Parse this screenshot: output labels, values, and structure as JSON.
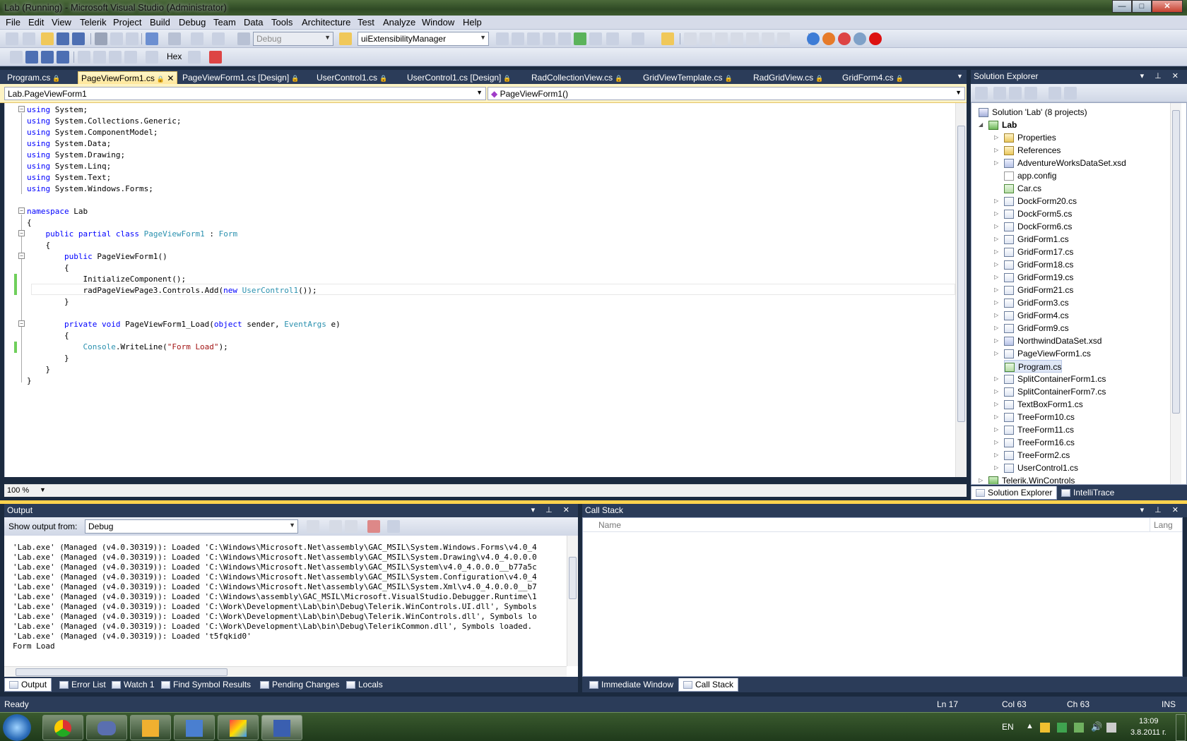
{
  "window": {
    "title": "Lab (Running) - Microsoft Visual Studio (Administrator)",
    "min": "—",
    "max": "□",
    "close": "✕"
  },
  "menu": [
    "File",
    "Edit",
    "View",
    "Telerik",
    "Project",
    "Build",
    "Debug",
    "Team",
    "Data",
    "Tools",
    "Architecture",
    "Test",
    "Analyze",
    "Window",
    "Help"
  ],
  "toolbar": {
    "config": "Debug",
    "find_combo": "uiExtensibilityManager",
    "hex": "Hex"
  },
  "doc_tabs": [
    {
      "label": "Program.cs",
      "active": false
    },
    {
      "label": "PageViewForm1.cs",
      "active": true
    },
    {
      "label": "PageViewForm1.cs [Design]",
      "active": false
    },
    {
      "label": "UserControl1.cs",
      "active": false
    },
    {
      "label": "UserControl1.cs [Design]",
      "active": false
    },
    {
      "label": "RadCollectionView.cs",
      "active": false
    },
    {
      "label": "GridViewTemplate.cs",
      "active": false
    },
    {
      "label": "RadGridView.cs",
      "active": false
    },
    {
      "label": "GridForm4.cs",
      "active": false
    }
  ],
  "nav": {
    "type_combo": "Lab.PageViewForm1",
    "member_combo": "PageViewForm1()"
  },
  "editor": {
    "zoom": "100 %"
  },
  "code_lines": [
    [
      [
        "using",
        "kw"
      ],
      [
        " System;",
        ""
      ]
    ],
    [
      [
        "using",
        "kw"
      ],
      [
        " System.Collections.Generic;",
        ""
      ]
    ],
    [
      [
        "using",
        "kw"
      ],
      [
        " System.ComponentModel;",
        ""
      ]
    ],
    [
      [
        "using",
        "kw"
      ],
      [
        " System.Data;",
        ""
      ]
    ],
    [
      [
        "using",
        "kw"
      ],
      [
        " System.Drawing;",
        ""
      ]
    ],
    [
      [
        "using",
        "kw"
      ],
      [
        " System.Linq;",
        ""
      ]
    ],
    [
      [
        "using",
        "kw"
      ],
      [
        " System.Text;",
        ""
      ]
    ],
    [
      [
        "using",
        "kw"
      ],
      [
        " System.Windows.Forms;",
        ""
      ]
    ],
    [],
    [
      [
        "namespace",
        "kw"
      ],
      [
        " Lab",
        ""
      ]
    ],
    [
      [
        "{",
        ""
      ]
    ],
    [
      [
        "    ",
        ""
      ],
      [
        "public",
        "kw"
      ],
      [
        " ",
        ""
      ],
      [
        "partial",
        "kw"
      ],
      [
        " ",
        ""
      ],
      [
        "class",
        "kw"
      ],
      [
        " ",
        ""
      ],
      [
        "PageViewForm1",
        "ty"
      ],
      [
        " : ",
        ""
      ],
      [
        "Form",
        "ty"
      ]
    ],
    [
      [
        "    {",
        ""
      ]
    ],
    [
      [
        "        ",
        ""
      ],
      [
        "public",
        "kw"
      ],
      [
        " PageViewForm1()",
        ""
      ]
    ],
    [
      [
        "        {",
        ""
      ]
    ],
    [
      [
        "            InitializeComponent();",
        ""
      ]
    ],
    [
      [
        "            radPageViewPage3.Controls.Add(",
        ""
      ],
      [
        "new",
        "kw"
      ],
      [
        " ",
        ""
      ],
      [
        "UserControl1",
        "ty"
      ],
      [
        "());",
        ""
      ]
    ],
    [
      [
        "        }",
        ""
      ]
    ],
    [],
    [
      [
        "        ",
        ""
      ],
      [
        "private",
        "kw"
      ],
      [
        " ",
        ""
      ],
      [
        "void",
        "kw"
      ],
      [
        " PageViewForm1_Load(",
        ""
      ],
      [
        "object",
        "kw"
      ],
      [
        " sender, ",
        ""
      ],
      [
        "EventArgs",
        "ty"
      ],
      [
        " e)",
        ""
      ]
    ],
    [
      [
        "        {",
        ""
      ]
    ],
    [
      [
        "            ",
        ""
      ],
      [
        "Console",
        "ty"
      ],
      [
        ".WriteLine(",
        ""
      ],
      [
        "\"Form Load\"",
        "st"
      ],
      [
        ");",
        ""
      ]
    ],
    [
      [
        "        }",
        ""
      ]
    ],
    [
      [
        "    }",
        ""
      ]
    ],
    [
      [
        "}",
        ""
      ]
    ]
  ],
  "solution_explorer": {
    "title": "Solution Explorer",
    "items": [
      {
        "label": "Solution 'Lab' (8 projects)",
        "indent": 0,
        "icon": "sol",
        "exp": ""
      },
      {
        "label": "Lab",
        "indent": 1,
        "icon": "proj",
        "exp": "◢",
        "bold": true
      },
      {
        "label": "Properties",
        "indent": 2,
        "icon": "folder",
        "exp": "▷"
      },
      {
        "label": "References",
        "indent": 2,
        "icon": "folder",
        "exp": "▷"
      },
      {
        "label": "AdventureWorksDataSet.xsd",
        "indent": 2,
        "icon": "xsd",
        "exp": "▷"
      },
      {
        "label": "app.config",
        "indent": 2,
        "icon": "cfg",
        "exp": ""
      },
      {
        "label": "Car.cs",
        "indent": 2,
        "icon": "cs",
        "exp": ""
      },
      {
        "label": "DockForm20.cs",
        "indent": 2,
        "icon": "frm",
        "exp": "▷"
      },
      {
        "label": "DockForm5.cs",
        "indent": 2,
        "icon": "frm",
        "exp": "▷"
      },
      {
        "label": "DockForm6.cs",
        "indent": 2,
        "icon": "frm",
        "exp": "▷"
      },
      {
        "label": "GridForm1.cs",
        "indent": 2,
        "icon": "frm",
        "exp": "▷"
      },
      {
        "label": "GridForm17.cs",
        "indent": 2,
        "icon": "frm",
        "exp": "▷"
      },
      {
        "label": "GridForm18.cs",
        "indent": 2,
        "icon": "frm",
        "exp": "▷"
      },
      {
        "label": "GridForm19.cs",
        "indent": 2,
        "icon": "frm",
        "exp": "▷"
      },
      {
        "label": "GridForm21.cs",
        "indent": 2,
        "icon": "frm",
        "exp": "▷"
      },
      {
        "label": "GridForm3.cs",
        "indent": 2,
        "icon": "frm",
        "exp": "▷"
      },
      {
        "label": "GridForm4.cs",
        "indent": 2,
        "icon": "frm",
        "exp": "▷"
      },
      {
        "label": "GridForm9.cs",
        "indent": 2,
        "icon": "frm",
        "exp": "▷"
      },
      {
        "label": "NorthwindDataSet.xsd",
        "indent": 2,
        "icon": "xsd",
        "exp": "▷"
      },
      {
        "label": "PageViewForm1.cs",
        "indent": 2,
        "icon": "frm",
        "exp": "▷"
      },
      {
        "label": "Program.cs",
        "indent": 2,
        "icon": "cs",
        "exp": "",
        "selected": true
      },
      {
        "label": "SplitContainerForm1.cs",
        "indent": 2,
        "icon": "frm",
        "exp": "▷"
      },
      {
        "label": "SplitContainerForm7.cs",
        "indent": 2,
        "icon": "frm",
        "exp": "▷"
      },
      {
        "label": "TextBoxForm1.cs",
        "indent": 2,
        "icon": "frm",
        "exp": "▷"
      },
      {
        "label": "TreeForm10.cs",
        "indent": 2,
        "icon": "frm",
        "exp": "▷"
      },
      {
        "label": "TreeForm11.cs",
        "indent": 2,
        "icon": "frm",
        "exp": "▷"
      },
      {
        "label": "TreeForm16.cs",
        "indent": 2,
        "icon": "frm",
        "exp": "▷"
      },
      {
        "label": "TreeForm2.cs",
        "indent": 2,
        "icon": "frm",
        "exp": "▷"
      },
      {
        "label": "UserControl1.cs",
        "indent": 2,
        "icon": "frm",
        "exp": "▷"
      },
      {
        "label": "Telerik.WinControls",
        "indent": 0,
        "icon": "proj",
        "exp": "▷"
      }
    ],
    "tabs": [
      "Solution Explorer",
      "IntelliTrace"
    ]
  },
  "output": {
    "title": "Output",
    "show_from_label": "Show output from:",
    "show_from_value": "Debug",
    "lines": [
      "'Lab.exe' (Managed (v4.0.30319)): Loaded 'C:\\Windows\\Microsoft.Net\\assembly\\GAC_MSIL\\System.Windows.Forms\\v4.0_4",
      "'Lab.exe' (Managed (v4.0.30319)): Loaded 'C:\\Windows\\Microsoft.Net\\assembly\\GAC_MSIL\\System.Drawing\\v4.0_4.0.0.0",
      "'Lab.exe' (Managed (v4.0.30319)): Loaded 'C:\\Windows\\Microsoft.Net\\assembly\\GAC_MSIL\\System\\v4.0_4.0.0.0__b77a5c",
      "'Lab.exe' (Managed (v4.0.30319)): Loaded 'C:\\Windows\\Microsoft.Net\\assembly\\GAC_MSIL\\System.Configuration\\v4.0_4",
      "'Lab.exe' (Managed (v4.0.30319)): Loaded 'C:\\Windows\\Microsoft.Net\\assembly\\GAC_MSIL\\System.Xml\\v4.0_4.0.0.0__b7",
      "'Lab.exe' (Managed (v4.0.30319)): Loaded 'C:\\Windows\\assembly\\GAC_MSIL\\Microsoft.VisualStudio.Debugger.Runtime\\1",
      "'Lab.exe' (Managed (v4.0.30319)): Loaded 'C:\\Work\\Development\\Lab\\bin\\Debug\\Telerik.WinControls.UI.dll', Symbols",
      "'Lab.exe' (Managed (v4.0.30319)): Loaded 'C:\\Work\\Development\\Lab\\bin\\Debug\\Telerik.WinControls.dll', Symbols lo",
      "'Lab.exe' (Managed (v4.0.30319)): Loaded 'C:\\Work\\Development\\Lab\\bin\\Debug\\TelerikCommon.dll', Symbols loaded.",
      "'Lab.exe' (Managed (v4.0.30319)): Loaded 't5fqkid0'",
      "Form Load"
    ],
    "tabs": [
      "Output",
      "Error List",
      "Watch 1",
      "Find Symbol Results",
      "Pending Changes",
      "Locals"
    ]
  },
  "call_stack": {
    "title": "Call Stack",
    "col_name": "Name",
    "col_lang": "Lang",
    "tabs": [
      "Immediate Window",
      "Call Stack"
    ]
  },
  "status": {
    "ready": "Ready",
    "ln": "Ln 17",
    "col": "Col 63",
    "ch": "Ch 63",
    "ins": "INS"
  },
  "taskbar": {
    "lang": "EN",
    "time": "13:09",
    "date": "3.8.2011 г."
  }
}
